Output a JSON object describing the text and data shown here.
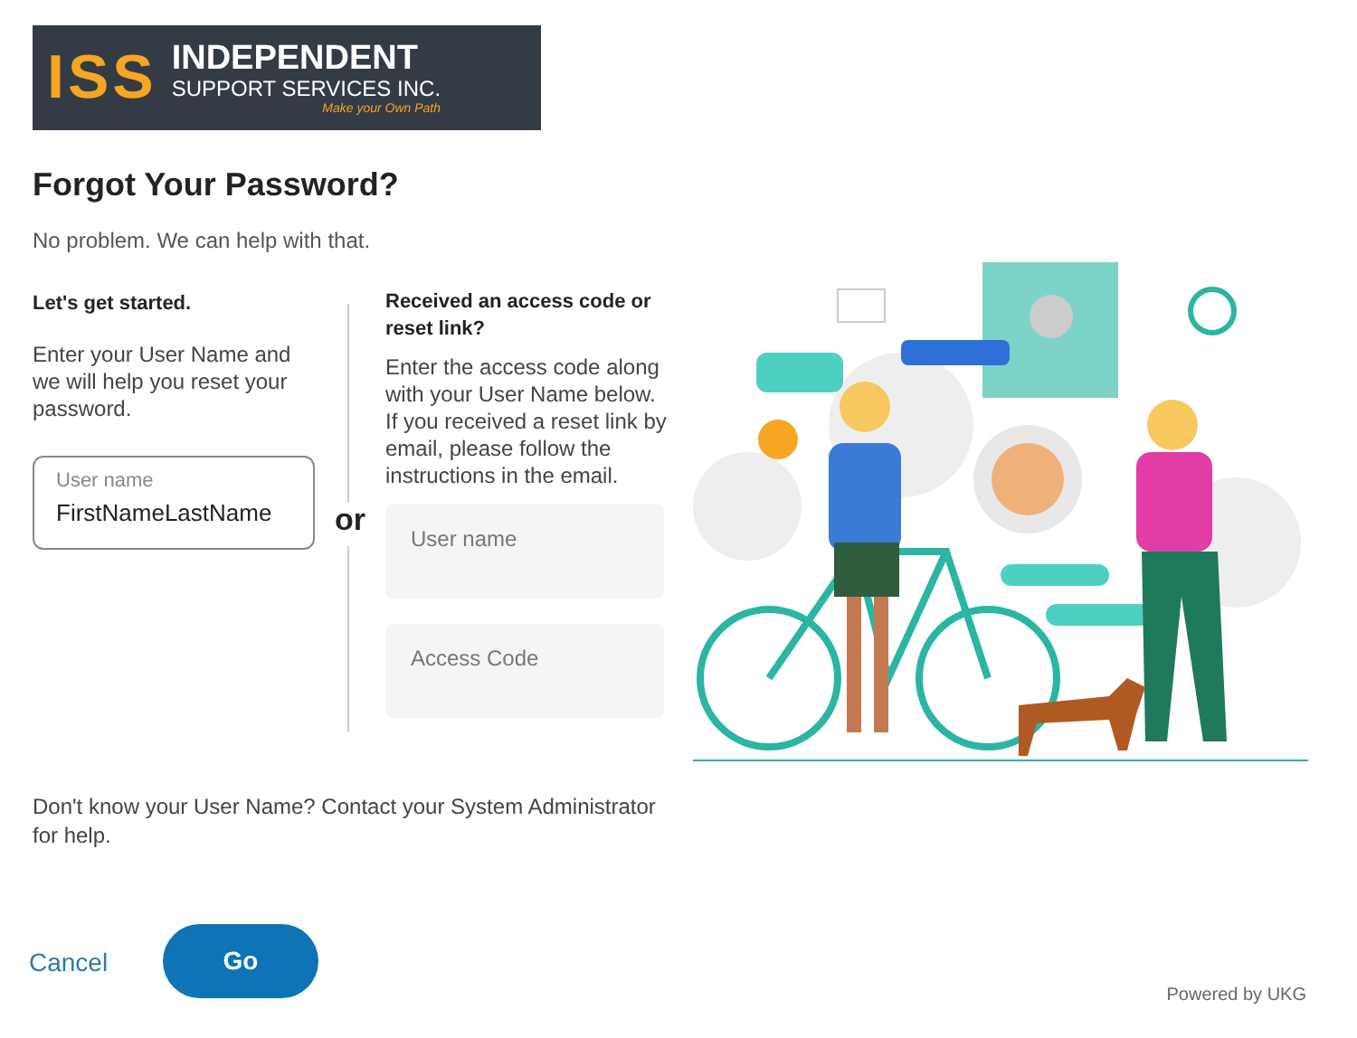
{
  "logo": {
    "mark": "ISS",
    "name": "INDEPENDENT",
    "subtitle": "SUPPORT SERVICES INC.",
    "tagline": "Make your Own Path"
  },
  "title": "Forgot Your Password?",
  "intro": "No problem. We can help with that.",
  "left": {
    "heading": "Let's get started.",
    "text": "Enter your User Name and we will help you reset your password.",
    "field": {
      "label": "User name",
      "value": "FirstNameLastName"
    }
  },
  "separator": "or",
  "right": {
    "heading": "Received an access code or reset link?",
    "text": "Enter the access code along with your User Name below. If you received a reset link by email, please follow the instructions in the email.",
    "fields": [
      {
        "placeholder": "User name"
      },
      {
        "placeholder": "Access Code"
      }
    ]
  },
  "help": "Don't know your User Name? Contact your System Administrator for help.",
  "buttons": {
    "cancel": "Cancel",
    "go": "Go"
  },
  "powered_by": "Powered by UKG"
}
